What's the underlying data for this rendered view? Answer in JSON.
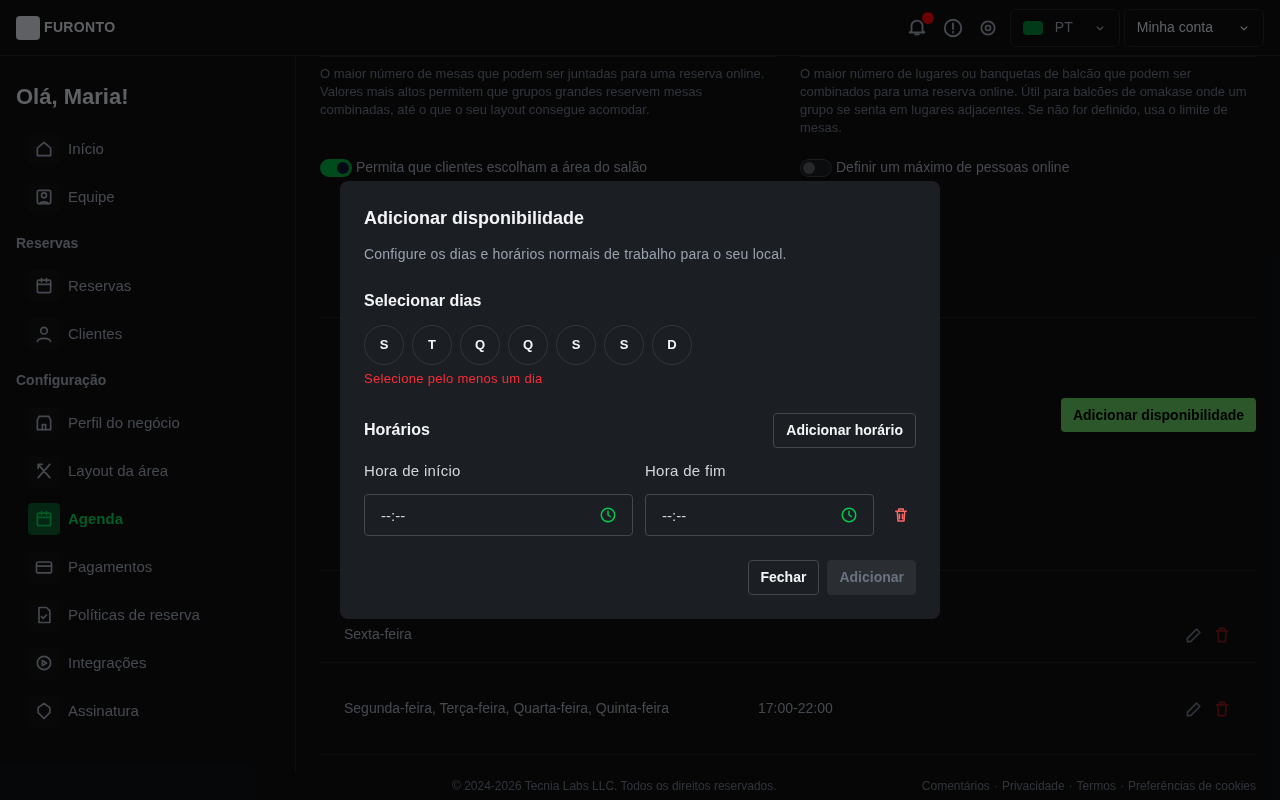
{
  "header": {
    "logo": "FURONTO",
    "language": "PT",
    "account": "Minha conta"
  },
  "sidebar": {
    "greeting": "Olá, Maria!",
    "sections": [
      {
        "items": [
          {
            "label": "Início",
            "selected": false
          },
          {
            "label": "Equipe",
            "selected": false
          }
        ]
      },
      {
        "title": "Reservas",
        "items": [
          {
            "label": "Reservas",
            "selected": false
          },
          {
            "label": "Clientes",
            "selected": false
          }
        ]
      },
      {
        "title": "Configuração",
        "items": [
          {
            "label": "Perfil do negócio",
            "selected": false
          },
          {
            "label": "Layout da área",
            "selected": false
          },
          {
            "label": "Agenda",
            "selected": true
          },
          {
            "label": "Pagamentos",
            "selected": false
          },
          {
            "label": "Políticas de reserva",
            "selected": false
          },
          {
            "label": "Integrações",
            "selected": false
          },
          {
            "label": "Assinatura",
            "selected": false
          }
        ]
      }
    ]
  },
  "settings": {
    "descriptions": [
      "O maior número de mesas que podem ser juntadas para uma reserva online. Valores mais altos permitem que grupos grandes reservem mesas combinadas, até o que o seu layout consegue acomodar.",
      "O maior número de lugares ou banquetas de balcão que podem ser combinados para uma reserva online. Útil para balcões de omakase onde um grupo se senta em lugares adjacentes. Se não for definido, usa o limite de mesas."
    ],
    "toggles": [
      {
        "label": "Permita que clientes escolham a área do salão",
        "on": true
      },
      {
        "label": "Definir um máximo de pessoas online",
        "on": false
      }
    ]
  },
  "availability": {
    "add_button": "Adicionar disponibilidade",
    "rows": [
      {
        "days": "Sexta-feira"
      },
      {
        "days": "Segunda-feira, Terça-feira, Quarta-feira, Quinta-feira",
        "hours": "17:00-22:00"
      }
    ]
  },
  "footer": {
    "copyright": "© 2024-2026 Tecnia Labs LLC. Todos os direitos reservados.",
    "links": [
      "Comentários",
      "Privacidade",
      "Termos",
      "Preferências de cookies"
    ],
    "separator": "·"
  },
  "dialog": {
    "title": "Adicionar disponibilidade",
    "description": "Configure os dias e horários normais de trabalho para o seu local.",
    "days_label": "Selecionar dias",
    "days": [
      {
        "label": "S",
        "selected": false
      },
      {
        "label": "T",
        "selected": false
      },
      {
        "label": "Q",
        "selected": false
      },
      {
        "label": "Q",
        "selected": false
      },
      {
        "label": "S",
        "selected": false
      },
      {
        "label": "S",
        "selected": false
      },
      {
        "label": "D",
        "selected": false
      }
    ],
    "error": "Selecione pelo menos um dia",
    "hours_label": "Horários",
    "add_hours_button": "Adicionar horário",
    "start": {
      "label": "Hora de início",
      "placeholder": "--:--"
    },
    "end": {
      "label": "Hora de fim",
      "placeholder": "--:--"
    },
    "close_button": "Fechar",
    "submit": {
      "label": "Adicionar",
      "disabled": true
    }
  }
}
